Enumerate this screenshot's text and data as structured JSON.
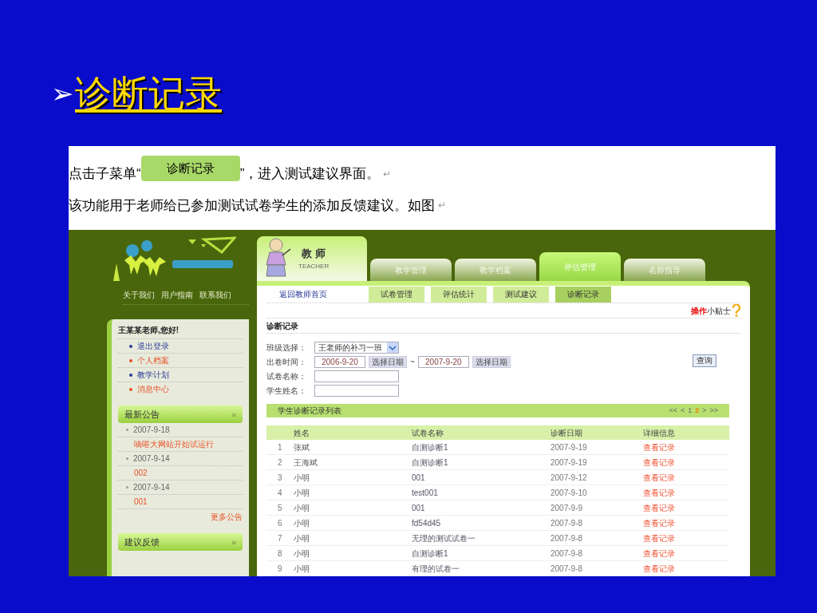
{
  "slide": {
    "bullet": "➢",
    "title": "诊断记录"
  },
  "document": {
    "lines": [
      {
        "kind": "button_line",
        "before": "点击子菜单“",
        "button": "诊断记录",
        "after": "”，进入测试建议界面。",
        "mark": "↵"
      },
      {
        "kind": "text_line",
        "text": "该功能用于老师给已参加测试试卷学生的添加反馈建议。如图",
        "mark": "↵"
      }
    ]
  },
  "app": {
    "header_links": [
      "关于我们",
      "用户指南",
      "联系我们"
    ],
    "greeting": "王某某老师,您好!",
    "menu": [
      {
        "label": "退出登录",
        "color": "#2a3a9a"
      },
      {
        "label": "个人档案",
        "color": "#e8502a"
      },
      {
        "label": "教学计划",
        "color": "#2a3a9a"
      },
      {
        "label": "消息中心",
        "color": "#e8502a"
      }
    ],
    "notice_panel": {
      "title": "最新公告",
      "arrow": "»",
      "items": [
        {
          "date": "2007-9-18",
          "title": "嘀嗒大网站开始试运行"
        },
        {
          "date": "2007-9-14",
          "title": "002"
        },
        {
          "date": "2007-9-14",
          "title": "001"
        }
      ],
      "more": "更多公告"
    },
    "feedback_panel": {
      "title": "建议反馈",
      "arrow": "»"
    },
    "role": {
      "title": "教 师",
      "subtitle": "TEACHER"
    },
    "tabs": [
      {
        "label": "教学管理",
        "selected": false
      },
      {
        "label": "教学档案",
        "selected": false
      },
      {
        "label": "评估管理",
        "selected": true
      },
      {
        "label": "名师指导",
        "selected": false
      }
    ],
    "home_link": "返回教师首页",
    "subtabs": [
      {
        "label": "试卷管理",
        "selected": false
      },
      {
        "label": "评估统计",
        "selected": false
      },
      {
        "label": "测试建议",
        "selected": false
      },
      {
        "label": "诊断记录",
        "selected": true
      }
    ],
    "tips": {
      "highlight": "操作",
      "rest": "小贴士"
    },
    "section_title": "诊断记录",
    "form": {
      "class_label": "班级选择：",
      "class_value": "王老师的补习一班",
      "time_label": "出卷时间：",
      "start_date": "2006-9-20",
      "start_button": "选择日期",
      "separator": "~",
      "end_date": "2007-9-20",
      "end_button": "选择日期",
      "paper_label": "试卷名称：",
      "student_label": "学生姓名：",
      "query_button": "查询"
    },
    "list": {
      "title": "学生诊断记录列表",
      "pager": [
        {
          "label": "<<",
          "selected": false
        },
        {
          "label": "<",
          "selected": false
        },
        {
          "label": "1",
          "selected": false
        },
        {
          "label": "2",
          "selected": true
        },
        {
          "label": ">",
          "selected": false
        },
        {
          "label": ">>",
          "selected": false
        }
      ],
      "columns": [
        "姓名",
        "试卷名称",
        "诊断日期",
        "详细信息"
      ],
      "rows": [
        {
          "index": "1",
          "name": "张斌",
          "paper": "自测诊断1",
          "date": "2007-9-19",
          "action": "查看记录"
        },
        {
          "index": "2",
          "name": "王海斌",
          "paper": "自测诊断1",
          "date": "2007-9-19",
          "action": "查看记录"
        },
        {
          "index": "3",
          "name": "小明",
          "paper": "001",
          "date": "2007-9-12",
          "action": "查看记录"
        },
        {
          "index": "4",
          "name": "小明",
          "paper": "test001",
          "date": "2007-9-10",
          "action": "查看记录"
        },
        {
          "index": "5",
          "name": "小明",
          "paper": "001",
          "date": "2007-9-9",
          "action": "查看记录"
        },
        {
          "index": "6",
          "name": "小明",
          "paper": "fd54d45",
          "date": "2007-9-8",
          "action": "查看记录"
        },
        {
          "index": "7",
          "name": "小明",
          "paper": "无理的测试试卷一",
          "date": "2007-9-8",
          "action": "查看记录"
        },
        {
          "index": "8",
          "name": "小明",
          "paper": "自测诊断1",
          "date": "2007-9-8",
          "action": "查看记录"
        },
        {
          "index": "9",
          "name": "小明",
          "paper": "有理的试卷一",
          "date": "2007-9-8",
          "action": "查看记录"
        }
      ]
    }
  }
}
